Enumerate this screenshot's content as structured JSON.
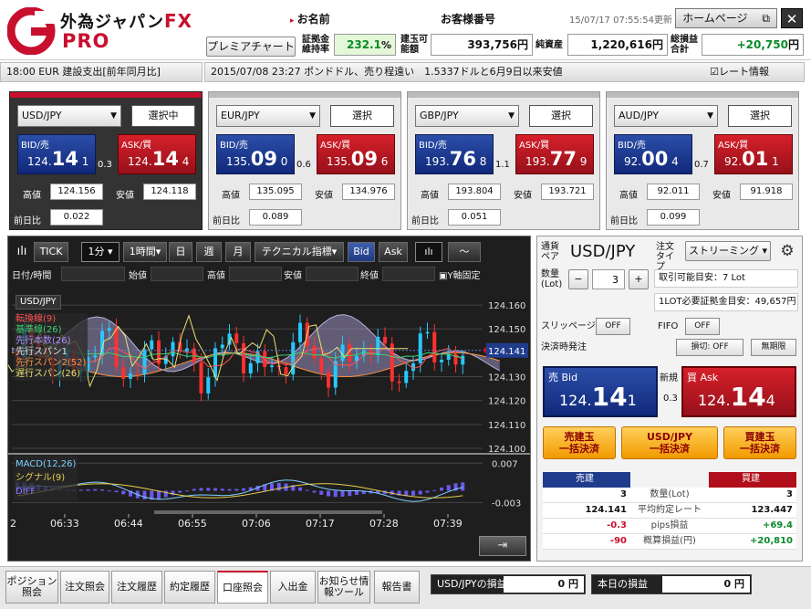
{
  "header": {
    "logo_title": "外為ジャパン",
    "logo_fx": "FX",
    "logo_pro": "PRO",
    "name_label": "お名前",
    "customer_no_label": "お客様番号",
    "datetime": "15/07/17 07:55:54更新",
    "home_button": "ホームページ",
    "premium_button": "プレミアチャート",
    "margin_rate_label": "証拠金維持率",
    "margin_rate_value": "232.1",
    "margin_rate_unit": "%",
    "available_label": "建玉可能額",
    "available_value": "393,756",
    "yen": "円",
    "net_assets_label": "純資産",
    "net_assets_value": "1,220,616",
    "total_pl_label": "総損益合計",
    "total_pl_value": "+20,750"
  },
  "newsbar": {
    "left": "18:00 EUR 建設支出[前年同月比]",
    "main": "2015/07/08 23:27  ポンドドル、売り程遠い　1.5337ドルと6月9日以来安値",
    "rate_info_label": "レート情報",
    "rate_info_check": "☑"
  },
  "labels": {
    "bid": "BID/売",
    "ask": "ASK/買",
    "high": "高値",
    "low": "安値",
    "prev": "前日比"
  },
  "panels": [
    {
      "pair": "USD/JPY",
      "button": "選択中",
      "bid_int": "124.",
      "bid_big": "14",
      "bid_small": "1",
      "ask_int": "124.",
      "ask_big": "14",
      "ask_small": "4",
      "spread": "0.3",
      "high": "124.156",
      "low": "124.118",
      "prev": "0.022"
    },
    {
      "pair": "EUR/JPY",
      "button": "選択",
      "bid_int": "135.",
      "bid_big": "09",
      "bid_small": "0",
      "ask_int": "135.",
      "ask_big": "09",
      "ask_small": "6",
      "spread": "0.6",
      "high": "135.095",
      "low": "134.976",
      "prev": "0.089"
    },
    {
      "pair": "GBP/JPY",
      "button": "選択",
      "bid_int": "193.",
      "bid_big": "76",
      "bid_small": "8",
      "ask_int": "193.",
      "ask_big": "77",
      "ask_small": "9",
      "spread": "1.1",
      "high": "193.804",
      "low": "193.721",
      "prev": "0.051"
    },
    {
      "pair": "AUD/JPY",
      "button": "選択",
      "bid_int": "92.",
      "bid_big": "00",
      "bid_small": "4",
      "ask_int": "92.",
      "ask_big": "01",
      "ask_small": "1",
      "spread": "0.7",
      "high": "92.011",
      "low": "91.918",
      "prev": "0.099"
    }
  ],
  "chart_toolbar": {
    "tick": "TICK",
    "interval": "1分",
    "hour": "1時間",
    "day": "日",
    "week": "週",
    "month": "月",
    "technical": "テクニカル指標",
    "bid": "Bid",
    "ask": "Ask",
    "date_label": "日付/時間",
    "open_label": "始値",
    "high_label": "高値",
    "low_label": "安値",
    "close_label": "終値",
    "yfix_label": "Y軸固定"
  },
  "chart_legend": {
    "pair": "USD/JPY",
    "items": [
      "転換線(9)",
      "基準線(26)",
      "先行本数(26)",
      "先行スパン1",
      "先行スパン2(52)",
      "遅行スパン(26)"
    ],
    "macd_items": [
      "MACD(12,26)",
      "シグナル(9)",
      "DIFF"
    ]
  },
  "chart_data": {
    "type": "line",
    "title": "USD/JPY",
    "y_ticks": [
      "124.160",
      "124.150",
      "124.141",
      "124.130",
      "124.120",
      "124.110",
      "124.100"
    ],
    "current_price": "124.141",
    "macd_ticks": [
      "0.007",
      "-0.003"
    ],
    "x_ticks": [
      "06:33",
      "06:44",
      "06:55",
      "07:06",
      "07:17",
      "07:28",
      "07:39"
    ],
    "x_first_tick_fragment": "2",
    "ylim": [
      124.1,
      124.165
    ],
    "colors": {
      "up": "#27c8ff",
      "down": "#ff3030",
      "tenkan": "#ff5050",
      "kijun": "#3fd070",
      "span1": "#9a8fc0",
      "chikou": "#e8e070",
      "macd": "#7fd0ff",
      "signal": "#e8d050",
      "diff": "#6a5af0"
    }
  },
  "order": {
    "pair_label": "通貨ペア",
    "pair": "USD/JPY",
    "type_label": "注文タイプ",
    "type_value": "ストリーミング",
    "qty_label": "数量(Lot)",
    "qty_value": "3",
    "minus": "−",
    "plus": "+",
    "tradable": "取引可能目安：7 Lot",
    "required_margin": "1LOT必要証拠金目安：49,657円",
    "slippage_label": "スリッページ",
    "slippage_value": "OFF",
    "fifo_label": "FIFO",
    "fifo_value": "OFF",
    "settle_label": "決済時発注",
    "stop_value": "損切: OFF",
    "unlimited_value": "無期限",
    "new_label": "新規",
    "sell_bid": "売 Bid",
    "buy_ask": "買 Ask",
    "bid_int": "124.",
    "bid_big": "14",
    "bid_small": "1",
    "ask_int": "124.",
    "ask_big": "14",
    "ask_small": "4",
    "spread": "0.3",
    "btn_sell_all_1": "売建玉",
    "btn_sell_all_2": "一括決済",
    "btn_pair_all_1": "USD/JPY",
    "btn_pair_all_2": "一括決済",
    "btn_buy_all_1": "買建玉",
    "btn_buy_all_2": "一括決済",
    "sell_header": "売建",
    "buy_header": "買建",
    "rows": [
      {
        "sell": "3",
        "label": "数量(Lot)",
        "buy": "3"
      },
      {
        "sell": "124.141",
        "label": "平均約定レート",
        "buy": "123.447"
      },
      {
        "sell": "-0.3",
        "label": "pips損益",
        "buy": "+69.4"
      },
      {
        "sell": "-90",
        "label": "概算損益(円)",
        "buy": "+20,810"
      }
    ]
  },
  "bottom": {
    "tabs": [
      "ポジション照会",
      "注文照会",
      "注文履歴",
      "約定履歴",
      "口座照会",
      "入出金",
      "お知らせ情報ツール",
      "報告書"
    ],
    "pair_pl_label": "USD/JPYの損益",
    "pair_pl_value": "0 円",
    "today_pl_label": "本日の損益",
    "today_pl_value": "0 円"
  }
}
